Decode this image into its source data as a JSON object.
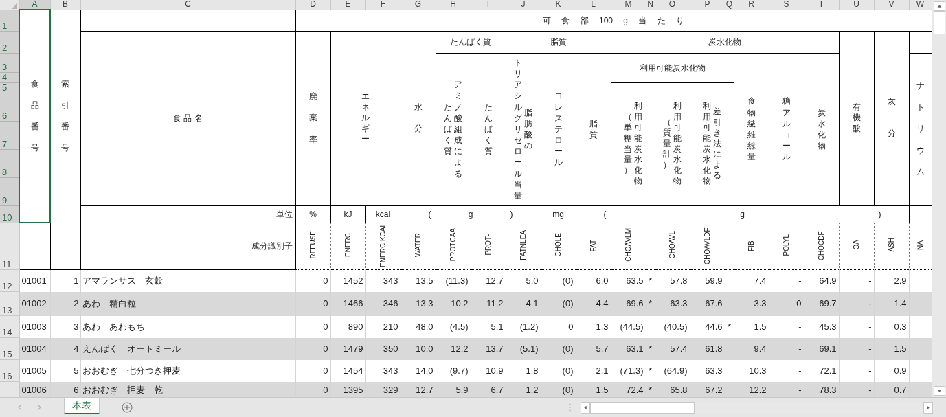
{
  "column_headers": [
    {
      "label": "A",
      "selected": true
    },
    {
      "label": "B",
      "selected": false
    },
    {
      "label": "C",
      "selected": false
    },
    {
      "label": "D",
      "selected": false
    },
    {
      "label": "E",
      "selected": false
    },
    {
      "label": "F",
      "selected": false
    },
    {
      "label": "G",
      "selected": false
    },
    {
      "label": "H",
      "selected": false
    },
    {
      "label": "I",
      "selected": false
    },
    {
      "label": "J",
      "selected": false
    },
    {
      "label": "K",
      "selected": false
    },
    {
      "label": "L",
      "selected": false
    },
    {
      "label": "M",
      "selected": false
    },
    {
      "label": "N",
      "selected": false
    },
    {
      "label": "O",
      "selected": false
    },
    {
      "label": "P",
      "selected": false
    },
    {
      "label": "Q",
      "selected": false
    },
    {
      "label": "R",
      "selected": false
    },
    {
      "label": "S",
      "selected": false
    },
    {
      "label": "T",
      "selected": false
    },
    {
      "label": "U",
      "selected": false
    },
    {
      "label": "V",
      "selected": false
    },
    {
      "label": "W",
      "selected": false
    }
  ],
  "row_headers": [
    {
      "label": "1",
      "selected": true
    },
    {
      "label": "2",
      "selected": true
    },
    {
      "label": "3",
      "selected": true
    },
    {
      "label": "4",
      "selected": true
    },
    {
      "label": "5",
      "selected": true
    },
    {
      "label": "6",
      "selected": true
    },
    {
      "label": "7",
      "selected": true
    },
    {
      "label": "8",
      "selected": true
    },
    {
      "label": "9",
      "selected": true
    },
    {
      "label": "10",
      "selected": true
    },
    {
      "label": "11",
      "selected": false
    },
    {
      "label": "12",
      "selected": false
    },
    {
      "label": "13",
      "selected": false
    },
    {
      "label": "14",
      "selected": false
    },
    {
      "label": "15",
      "selected": false
    },
    {
      "label": "16",
      "selected": false
    }
  ],
  "title": "可 食 部 100 g 当 た り",
  "header_cells": [
    {
      "lines": [
        "食品番号"
      ]
    },
    {
      "lines": [
        "索引番号"
      ]
    },
    {
      "text": "食 品 名"
    },
    {
      "lines": [
        "廃棄率"
      ]
    },
    {
      "lines": [
        "エネルギー"
      ]
    },
    {
      "lines": [
        "水分"
      ]
    },
    {
      "text": "たんぱく質"
    },
    {
      "text": "脂質"
    },
    {
      "text": "炭水化物"
    },
    {
      "lines": [
        "有機酸"
      ]
    },
    {
      "lines": [
        "灰分"
      ]
    },
    {
      "lines": [
        "たんぱく質",
        "アミノ酸組成による"
      ]
    },
    {
      "lines": [
        "たんぱく質"
      ]
    },
    {
      "lines": [
        "トリアシルグリセロール当量",
        "脂肪酸の"
      ]
    },
    {
      "lines": [
        "コレステロール"
      ]
    },
    {
      "lines": [
        "脂質"
      ]
    },
    {
      "text": "利用可能炭水化物"
    },
    {
      "lines": [
        "食物繊維総量"
      ]
    },
    {
      "lines": [
        "糖アルコール"
      ]
    },
    {
      "lines": [
        "炭水化物"
      ]
    },
    {
      "lines": [
        "ナトリウム"
      ]
    },
    {
      "lines": [
        "（単糖当量）",
        "利用可能炭水化物"
      ]
    },
    {
      "lines": [
        "（質量計）",
        "利用可能炭水化物"
      ]
    },
    {
      "lines": [
        "利用可能炭水化物",
        "差引き法による"
      ]
    }
  ],
  "units": [
    {
      "kind": "label",
      "text": "単位"
    },
    {
      "kind": "unit",
      "text": "%"
    },
    {
      "kind": "unit",
      "text": "kJ"
    },
    {
      "kind": "unit",
      "text": "kcal"
    },
    {
      "kind": "bracket",
      "open": "(",
      "text": "g",
      "close": ")"
    },
    {
      "kind": "unit",
      "text": "mg"
    },
    {
      "kind": "bracket",
      "open": "(",
      "text": "g",
      "close": ")"
    }
  ],
  "identifier_label": "成分識別子",
  "identifiers": [
    "REFUSE",
    "ENERC",
    "ENERC KCAL",
    "WATER",
    "PROTCAA",
    "PROT-",
    "FATNLEA",
    "CHOLE",
    "FAT-",
    "CHOAVLM",
    "CHOAVL",
    "CHOAVLDF-",
    "FIB-",
    "POLYL",
    "CHOCDF-",
    "OA",
    "ASH",
    "NA"
  ],
  "rows": [
    {
      "food_id": "01001",
      "index": "1",
      "name": "アマランサス　玄穀",
      "shaded": false,
      "values": [
        "0",
        "1452",
        "343",
        "13.5",
        "(11.3)",
        "12.7",
        "5.0",
        "(0)",
        "6.0",
        "63.5",
        "57.8",
        "59.9",
        "7.4",
        "-",
        "64.9",
        "-",
        "2.9"
      ],
      "n_mark": "*"
    },
    {
      "food_id": "01002",
      "index": "2",
      "name": "あわ　精白粒",
      "shaded": true,
      "values": [
        "0",
        "1466",
        "346",
        "13.3",
        "10.2",
        "11.2",
        "4.1",
        "(0)",
        "4.4",
        "69.6",
        "63.3",
        "67.6",
        "3.3",
        "0",
        "69.7",
        "-",
        "1.4"
      ],
      "n_mark": "*"
    },
    {
      "food_id": "01003",
      "index": "3",
      "name": "あわ　あわもち",
      "shaded": false,
      "values": [
        "0",
        "890",
        "210",
        "48.0",
        "(4.5)",
        "5.1",
        "(1.2)",
        "0",
        "1.3",
        "(44.5)",
        "(40.5)",
        "44.6",
        "1.5",
        "-",
        "45.3",
        "-",
        "0.3"
      ],
      "q_mark": "*"
    },
    {
      "food_id": "01004",
      "index": "4",
      "name": "えんばく　オートミール",
      "shaded": true,
      "values": [
        "0",
        "1479",
        "350",
        "10.0",
        "12.2",
        "13.7",
        "(5.1)",
        "(0)",
        "5.7",
        "63.1",
        "57.4",
        "61.8",
        "9.4",
        "-",
        "69.1",
        "-",
        "1.5"
      ],
      "n_mark": "*"
    },
    {
      "food_id": "01005",
      "index": "5",
      "name": "おおむぎ　七分つき押麦",
      "shaded": false,
      "values": [
        "0",
        "1454",
        "343",
        "14.0",
        "(9.7)",
        "10.9",
        "1.8",
        "(0)",
        "2.1",
        "(71.3)",
        "(64.9)",
        "63.3",
        "10.3",
        "-",
        "72.1",
        "-",
        "0.9"
      ],
      "n_mark": "*"
    },
    {
      "food_id": "01006",
      "index": "6",
      "name": "おおむぎ　押麦　乾",
      "shaded": true,
      "values": [
        "0",
        "1395",
        "329",
        "12.7",
        "5.9",
        "6.7",
        "1.2",
        "(0)",
        "1.5",
        "72.4",
        "65.8",
        "67.2",
        "12.2",
        "-",
        "78.3",
        "-",
        "0.7"
      ],
      "n_mark": "*"
    }
  ],
  "sheet_tabs": [
    {
      "label": "本表",
      "selected": true
    }
  ]
}
